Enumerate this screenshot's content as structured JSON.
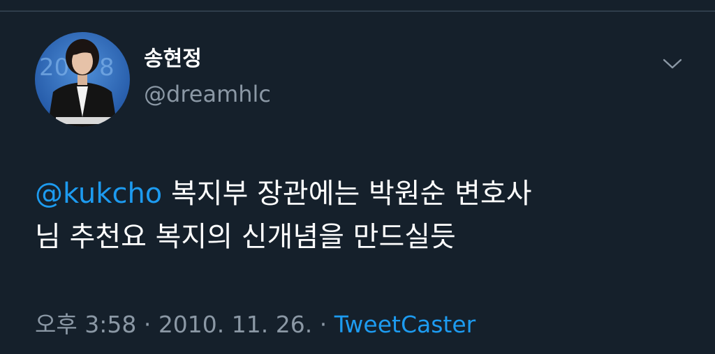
{
  "tweet": {
    "author": {
      "display_name": "송현정",
      "handle": "@dreamhlc",
      "avatar_icon": "profile-photo"
    },
    "menu_icon": "chevron-down-icon",
    "text": {
      "mention": "@kukcho",
      "line1_rest": " 복지부 장관에는 박원순 변호사",
      "line2": "님 추천요 복지의 신개념을 만드실듯"
    },
    "meta": {
      "time": "오후 3:58",
      "separator": " · ",
      "date": "2010. 11. 26.",
      "source": "TweetCaster"
    },
    "colors": {
      "background": "#15202b",
      "link": "#1d9bf0",
      "secondary_text": "#8b98a5"
    }
  }
}
